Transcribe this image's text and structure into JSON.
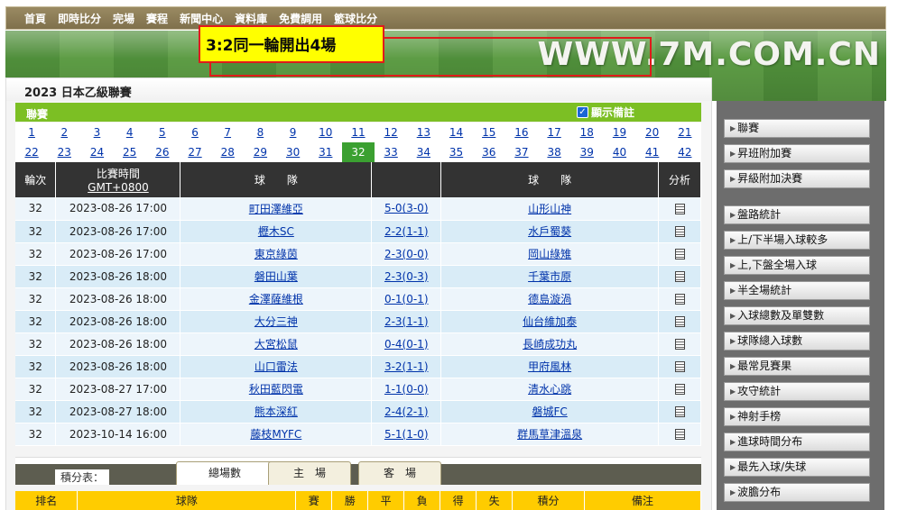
{
  "nav": [
    "首頁",
    "即時比分",
    "完場",
    "賽程",
    "新聞中心",
    "資料庫",
    "免費調用",
    "籃球比分"
  ],
  "banner": {
    "site": "WWW.7M.COM.CN",
    "notice": "3:2同一輪開出4場"
  },
  "league_title": "2023 日本乙級聯賽",
  "round_bar": {
    "label": "聯賽",
    "show_remark": "顯示備註"
  },
  "rounds_row1": [
    "1",
    "2",
    "3",
    "4",
    "5",
    "6",
    "7",
    "8",
    "9",
    "10",
    "11",
    "12",
    "13",
    "14",
    "15",
    "16",
    "17",
    "18",
    "19",
    "20",
    "21"
  ],
  "rounds_row2": [
    "22",
    "23",
    "24",
    "25",
    "26",
    "27",
    "28",
    "29",
    "30",
    "31",
    "32",
    "33",
    "34",
    "35",
    "36",
    "37",
    "38",
    "39",
    "40",
    "41",
    "42"
  ],
  "table_headers": {
    "round": "輪次",
    "time": "比賽時間",
    "timezone": "GMT+0800",
    "home": "球　　隊",
    "score": "",
    "away": "球　　隊",
    "analysis": "分析"
  },
  "matches": [
    {
      "round": "32",
      "time": "2023-08-26 17:00",
      "home": "町田澤維亞",
      "score": "5-0(3-0)",
      "away": "山形山神"
    },
    {
      "round": "32",
      "time": "2023-08-26 17:00",
      "home": "櫪木SC",
      "score": "2-2(1-1)",
      "away": "水戶蜀葵"
    },
    {
      "round": "32",
      "time": "2023-08-26 17:00",
      "home": "東京綠茵",
      "score": "2-3(0-0)",
      "away": "岡山綠雉"
    },
    {
      "round": "32",
      "time": "2023-08-26 18:00",
      "home": "磐田山葉",
      "score": "2-3(0-3)",
      "away": "千葉市原"
    },
    {
      "round": "32",
      "time": "2023-08-26 18:00",
      "home": "金澤薩維根",
      "score": "0-1(0-1)",
      "away": "德島漩渦"
    },
    {
      "round": "32",
      "time": "2023-08-26 18:00",
      "home": "大分三神",
      "score": "2-3(1-1)",
      "away": "仙台維加泰"
    },
    {
      "round": "32",
      "time": "2023-08-26 18:00",
      "home": "大宮松鼠",
      "score": "0-4(0-1)",
      "away": "長崎成功丸"
    },
    {
      "round": "32",
      "time": "2023-08-26 18:00",
      "home": "山口雷法",
      "score": "3-2(1-1)",
      "away": "甲府風林"
    },
    {
      "round": "32",
      "time": "2023-08-27 17:00",
      "home": "秋田藍閃電",
      "score": "1-1(0-0)",
      "away": "清水心跳"
    },
    {
      "round": "32",
      "time": "2023-08-27 18:00",
      "home": "熊本深紅",
      "score": "2-4(2-1)",
      "away": "磐城FC"
    },
    {
      "round": "32",
      "time": "2023-10-14 16:00",
      "home": "藤枝MYFC",
      "score": "5-1(1-0)",
      "away": "群馬草津溫泉"
    }
  ],
  "standings": {
    "label": "積分表：",
    "tabs": [
      "總場數",
      "主　場",
      "客　場"
    ],
    "headers": [
      "排名",
      "球隊",
      "賽",
      "勝",
      "平",
      "負",
      "得",
      "失",
      "積分",
      "備注"
    ]
  },
  "sidebar": [
    "聯賽",
    "昇班附加賽",
    "昇級附加決賽",
    "盤路統計",
    "上/下半場入球較多",
    "上,下盤全場入球",
    "半全場統計",
    "入球總數及單雙數",
    "球隊總入球數",
    "最常見賽果",
    "攻守統計",
    "神射手榜",
    "進球時間分布",
    "最先入球/失球",
    "波膽分布"
  ],
  "colors": {
    "accent_green": "#7cbf24",
    "active_round": "#3ba031",
    "header_dark": "#333333",
    "standings_header": "#ffcc00",
    "sidebar_bg": "#6d6d6d",
    "notice_bg": "#ffff00",
    "notice_border": "#e01b1b"
  },
  "icons": {
    "analysis": "analysis-sheet-icon",
    "sidebar_arrow": "triangle-right-icon",
    "remark_checkbox": "checkbox-checked-icon"
  }
}
